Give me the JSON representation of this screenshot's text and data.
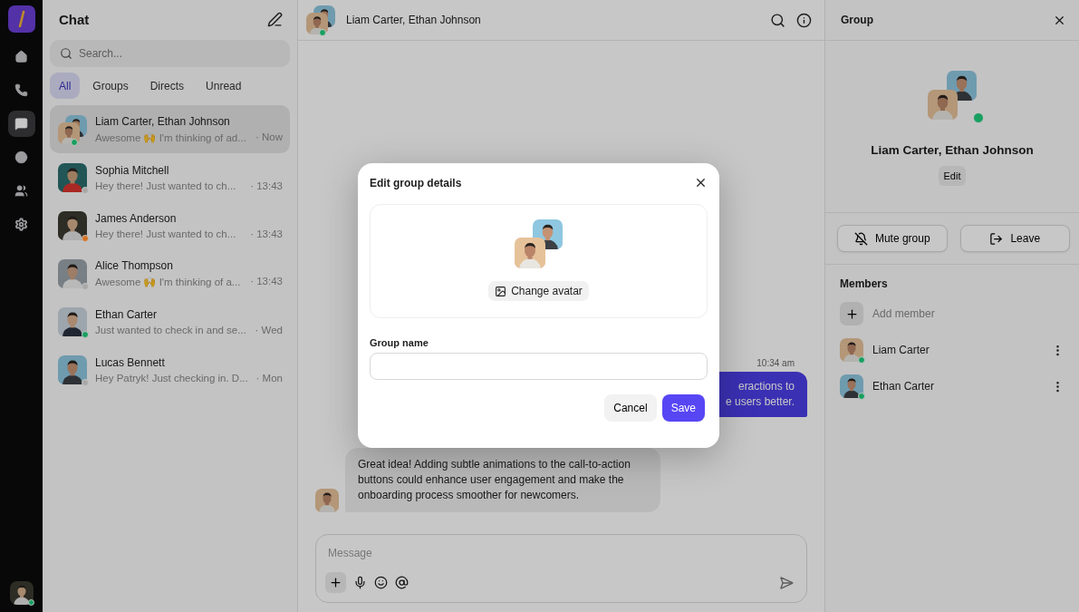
{
  "rail": {
    "items": [
      {
        "kind": "home",
        "selected": false
      },
      {
        "kind": "phone",
        "selected": false
      },
      {
        "kind": "chat",
        "selected": true
      },
      {
        "kind": "profile",
        "selected": false
      },
      {
        "kind": "people",
        "selected": false
      },
      {
        "kind": "settings",
        "selected": false
      }
    ],
    "user_online": true
  },
  "chat_list": {
    "title": "Chat",
    "search": {
      "placeholder": "Search..."
    },
    "filters": [
      {
        "label": "All",
        "selected": true
      },
      {
        "label": "Groups",
        "selected": false
      },
      {
        "label": "Directs",
        "selected": false
      },
      {
        "label": "Unread",
        "selected": false
      }
    ],
    "chats": [
      {
        "kind": "group",
        "name": "Liam Carter, Ethan Johnson",
        "preview": "Awesome 🙌 I'm thinking of ad...",
        "time": "· Now",
        "color": "#17a060",
        "selected": true
      },
      {
        "kind": "single",
        "name": "Sophia Mitchell",
        "preview": "Hey there! Just wanted to ch...",
        "time": "· 13:43",
        "color": "#a8a8a8",
        "selected": false
      },
      {
        "kind": "single",
        "name": "James Anderson",
        "preview": "Hey there! Just wanted to ch...",
        "time": "· 13:43",
        "color": "#d9731f",
        "selected": false
      },
      {
        "kind": "single",
        "name": "Alice Thompson",
        "preview": "Awesome 🙌 I'm thinking of a...",
        "time": "· 13:43",
        "color": "#a8a8a8",
        "selected": false
      },
      {
        "kind": "single",
        "name": "Ethan Carter",
        "preview": "Just wanted to check in and se...",
        "time": "· Wed",
        "color": "#17a060",
        "selected": false
      },
      {
        "kind": "single",
        "name": "Lucas Bennett",
        "preview": "Hey Patryk! Just checking in. D...",
        "time": "· Mon",
        "color": "#a8a8a8",
        "selected": false
      }
    ]
  },
  "conversation": {
    "title": "Liam Carter, Ethan Johnson",
    "online": true,
    "messages": [
      {
        "kind": "outgoing",
        "time": "10:34 am",
        "lines": [
          "eractions to",
          "e users better."
        ]
      },
      {
        "kind": "incoming",
        "text": "Great idea! Adding subtle animations to the call-to-action buttons could enhance user engagement and make the onboarding process smoother for newcomers."
      }
    ],
    "composer": {
      "placeholder": "Message"
    }
  },
  "group_panel": {
    "title": "Group",
    "name": "Liam Carter, Ethan Johnson",
    "online": true,
    "edit": "Edit",
    "mute": "Mute group",
    "leave": "Leave",
    "members_title": "Members",
    "add_member": "Add member",
    "members": [
      {
        "name": "Liam Carter",
        "color": "#17a060"
      },
      {
        "name": "Ethan Carter",
        "color": "#17a060"
      }
    ]
  },
  "dialog": {
    "title": "Edit group details",
    "change_avatar": "Change avatar",
    "field_label": "Group name",
    "cancel": "Cancel",
    "save": "Save"
  }
}
